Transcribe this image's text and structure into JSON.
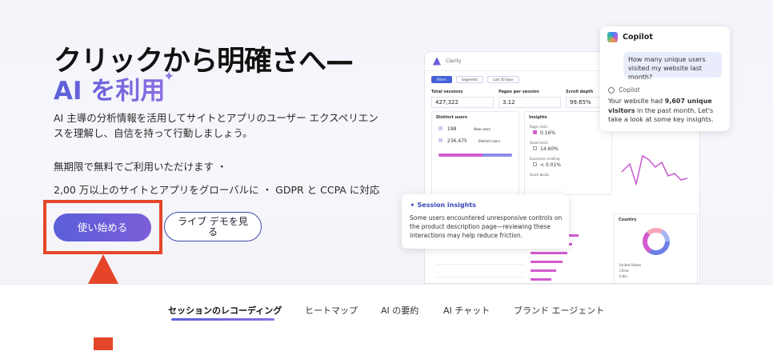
{
  "hero": {
    "headline": "クリックから明確さへ—",
    "subhead": "AI を利用",
    "description": "AI 主導の分析情報を活用してサイトとアプリのユーザー エクスペリエンスを理解し、自信を持って行動しましょう。",
    "bullet1": "無期限で無料でご利用いただけます ・",
    "bullet2": "2,00 万以上のサイトとアプリをグローバルに ・ GDPR と CCPA に対応",
    "cta_primary": "使い始める",
    "cta_secondary": "ライブ デモを見る"
  },
  "dashboard": {
    "brand": "Clarity",
    "filters": [
      "Filters",
      "Segments",
      "Last 30 days"
    ],
    "kpis": [
      {
        "label": "Total sessions",
        "value": "427,322"
      },
      {
        "label": "Pages per session",
        "value": "3.12"
      },
      {
        "label": "Scroll depth",
        "value": "99.65%"
      }
    ],
    "distinct_users": {
      "title": "Distinct users",
      "new": "198",
      "total": "236,475",
      "new_label": "New users",
      "total_label": "Distinct users"
    },
    "insights": {
      "title": "Insights",
      "rows": [
        {
          "label": "Rage clicks",
          "value": "0.16%"
        },
        {
          "label": "Dead clicks",
          "value": "14.60%"
        },
        {
          "label": "Excessive scrolling",
          "value": "< 0.01%"
        },
        {
          "label": "Quick backs",
          "value": ""
        }
      ]
    },
    "country": {
      "title": "Country",
      "legend": [
        "United States",
        "China",
        "India"
      ]
    }
  },
  "copilot": {
    "title": "Copilot",
    "question": "How many unique users visited my website last month?",
    "sub": "Copilot",
    "answer_pre": "Your website had ",
    "answer_bold": "9,607 unique visitors",
    "answer_post": " in the past month. Let's take a look at some key insights."
  },
  "session": {
    "title": "Session insights",
    "body": "Some users encountered unresponsive controls on the product description page—reviewing these interactions may help reduce friction."
  },
  "tabs": [
    {
      "label": "セッションのレコーディング"
    },
    {
      "label": "ヒートマップ"
    },
    {
      "label": "AI の要約"
    },
    {
      "label": "AI チャット"
    },
    {
      "label": "ブランド エージェント"
    }
  ]
}
